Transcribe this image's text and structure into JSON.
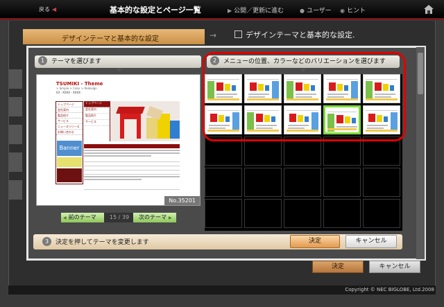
{
  "topbar": {
    "back": "戻る",
    "title": "基本的な設定とページ一覧",
    "publish": "公開／更新に進む",
    "user": "ユーザー",
    "hint": "ヒント"
  },
  "background": {
    "tab_label": "デザインテーマと基本的な設定",
    "heading": "デザインテーマと基本的な設定.",
    "decide": "決定",
    "cancel": "キャンセル",
    "copyright": "Copyright © NEC BIGLOBE, Ltd.2008"
  },
  "modal": {
    "step1": {
      "num": "1",
      "label": "テーマを選びます"
    },
    "step2": {
      "num": "2",
      "label": "メニューの位置、カラーなどのバリエーションを選びます"
    },
    "step3": {
      "num": "3",
      "label": "決定を押してテーマを変更します"
    },
    "preview": {
      "logo": "TSUMIKI - Theme",
      "subtitle": "> Simple > Color > Redesign",
      "tel": "03 - XXXX - XXXX",
      "menu": [
        "トップページ",
        "会社案内",
        "製品紹介",
        "サービス",
        "ニュースリリース",
        "お問い合わせ"
      ],
      "banner": "Banner",
      "theme_number": "No.35201"
    },
    "pager": {
      "prev": "前のテーマ",
      "count": "15 / 39",
      "next": "次のテーマ"
    },
    "buttons": {
      "decide": "決定",
      "cancel": "キャンセル"
    }
  },
  "colors": {
    "accent_red": "#8b0d0d",
    "highlight_red": "#e00000",
    "selected_green": "#7adc36",
    "decide_orange": "#e29a52"
  },
  "variations": {
    "count": 10,
    "selected_index": 8
  }
}
